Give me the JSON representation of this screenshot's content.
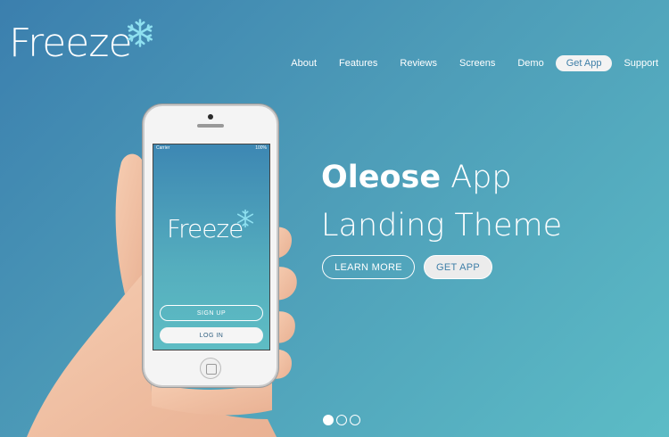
{
  "logo": {
    "text": "Freeze"
  },
  "nav": {
    "items": [
      "About",
      "Features",
      "Reviews",
      "Screens",
      "Demo",
      "Get App",
      "Support"
    ],
    "active_index": 5
  },
  "hero": {
    "title_bold": "Oleose",
    "title_rest": " App",
    "title_line2": "Landing Theme",
    "learn_more": "LEARN MORE",
    "get_app": "GET APP"
  },
  "phone": {
    "carrier": "Carrier",
    "battery": "100%",
    "app_logo": "Freeze",
    "sign_up": "SIGN UP",
    "log_in": "LOG IN"
  },
  "slider": {
    "count": 3,
    "active_index": 0
  },
  "colors": {
    "accent": "#3f7fa8",
    "bg_start": "#3b7fae",
    "bg_end": "#5cbcc6"
  }
}
